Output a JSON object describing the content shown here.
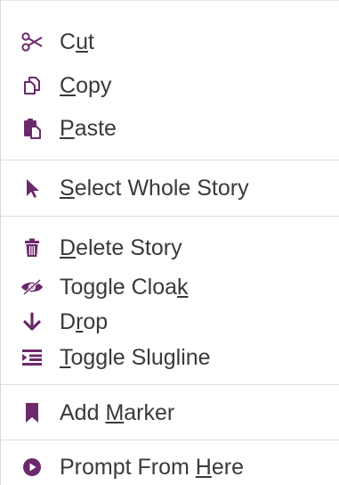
{
  "theme": {
    "icon_color": "#6b2a6b",
    "text_color": "#3a3a3a",
    "divider_color": "#dcdcdc"
  },
  "menu": {
    "items": [
      {
        "label": "Cut",
        "mnemonic_index": 1,
        "icon": "scissors-icon"
      },
      {
        "label": "Copy",
        "mnemonic_index": 0,
        "icon": "copy-icon"
      },
      {
        "label": "Paste",
        "mnemonic_index": 0,
        "icon": "paste-icon"
      },
      {
        "label": "Select Whole Story",
        "mnemonic_index": 0,
        "icon": "pointer-icon"
      },
      {
        "label": "Delete Story",
        "mnemonic_index": 0,
        "icon": "trash-icon"
      },
      {
        "label": "Toggle Cloak",
        "mnemonic_index": 11,
        "icon": "cloak-eye-icon"
      },
      {
        "label": "Drop",
        "mnemonic_index": 1,
        "icon": "arrow-down-icon"
      },
      {
        "label": "Toggle Slugline",
        "mnemonic_index": 0,
        "icon": "slugline-icon"
      },
      {
        "label": "Add Marker",
        "mnemonic_index": 4,
        "icon": "bookmark-icon"
      },
      {
        "label": "Prompt From Here",
        "mnemonic_index": 12,
        "icon": "play-circle-icon"
      }
    ]
  }
}
